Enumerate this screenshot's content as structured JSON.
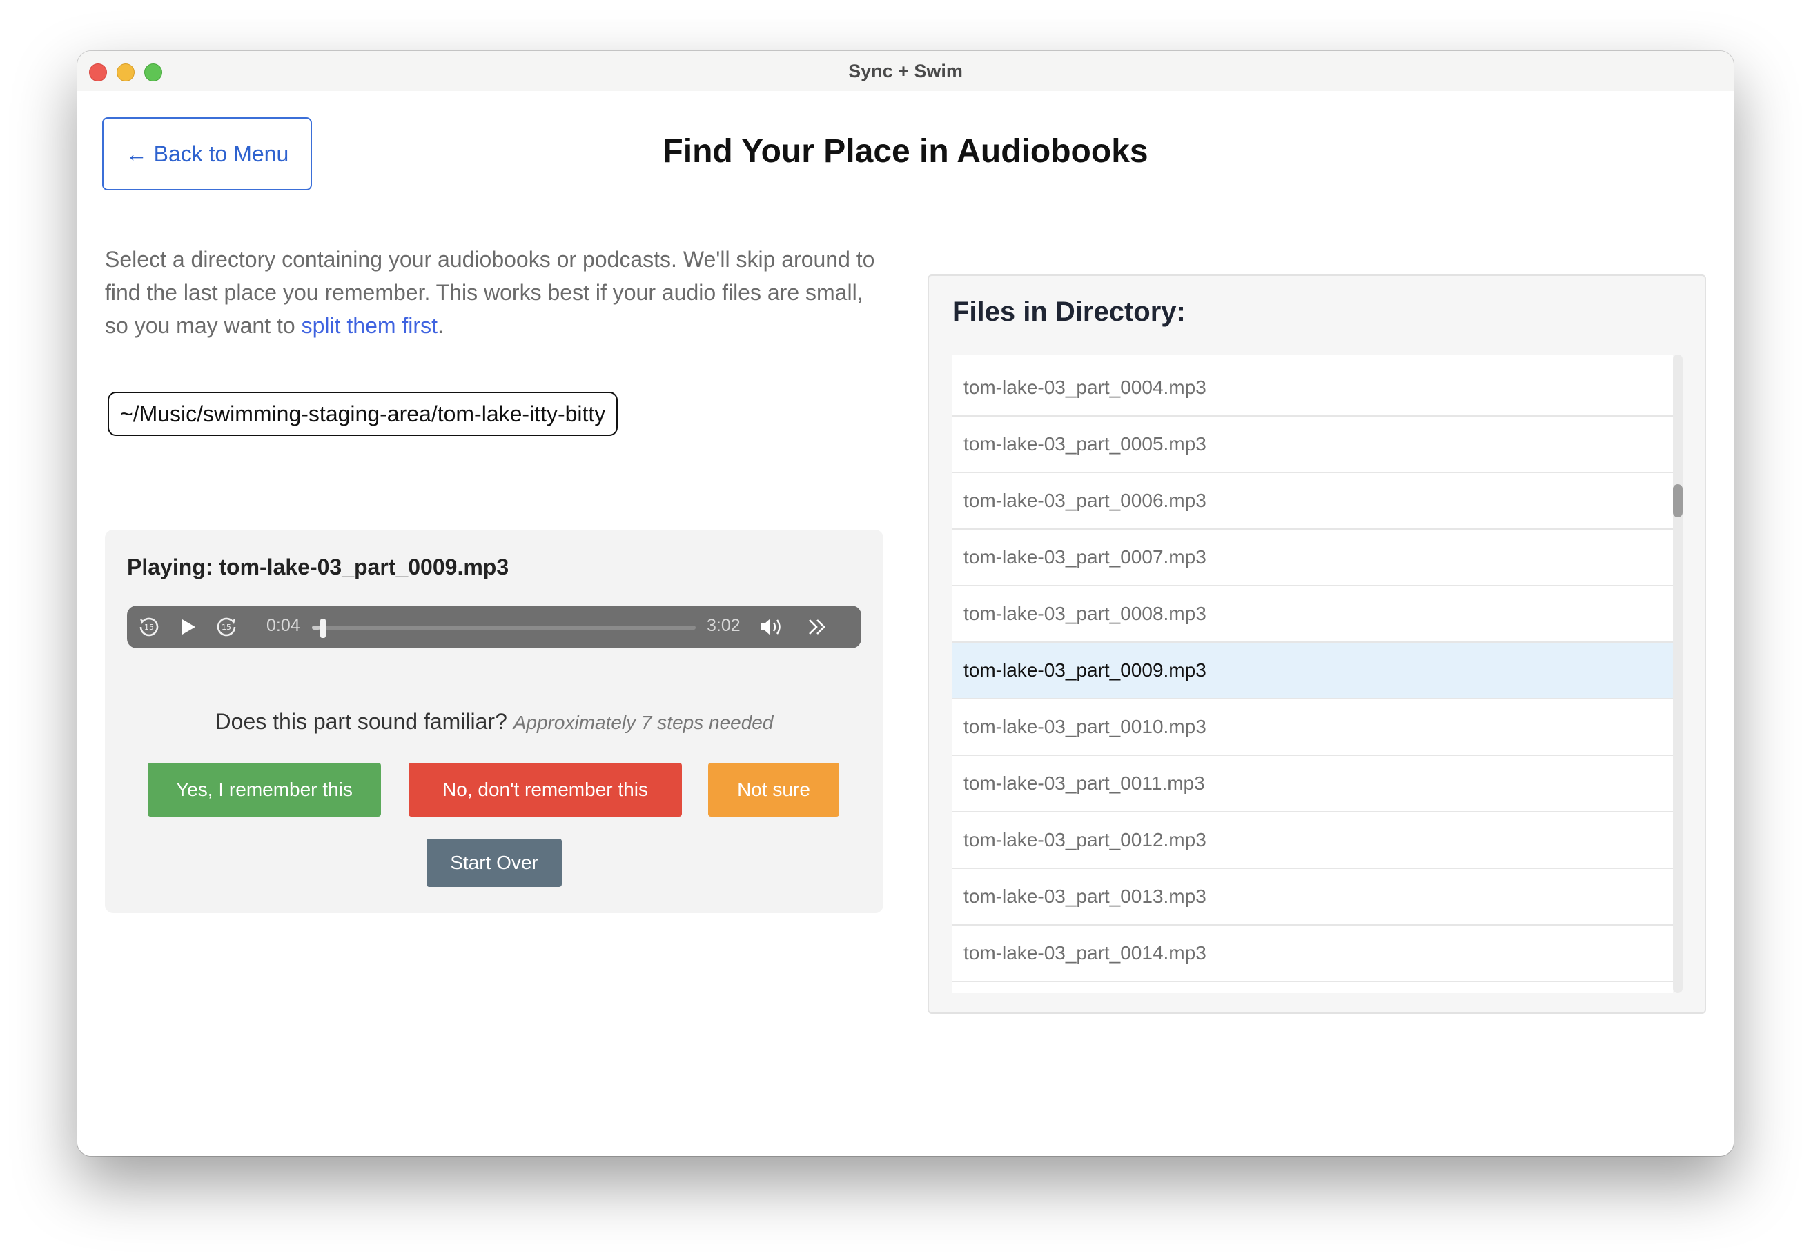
{
  "window": {
    "title": "Sync + Swim"
  },
  "nav": {
    "back_label": "← Back to Menu"
  },
  "page": {
    "title": "Find Your Place in Audiobooks"
  },
  "intro": {
    "text": "Select a directory containing your audiobooks or podcasts. We'll skip around to find the last place you remember. This works best if your audio files are small, so you may want to ",
    "link_text": "split them first",
    "suffix": "."
  },
  "directory": {
    "path": "~/Music/swimming-staging-area/tom-lake-itty-bitty"
  },
  "player": {
    "playing_label": "Playing: tom-lake-03_part_0009.mp3",
    "current_time": "0:04",
    "duration": "3:02",
    "progress_fraction": 0.022
  },
  "prompt": {
    "question": "Does this part sound familiar?",
    "hint": "Approximately 7 steps needed"
  },
  "actions": {
    "yes": "Yes, I remember this",
    "no": "No, don't remember this",
    "not_sure": "Not sure",
    "start_over": "Start Over"
  },
  "files": {
    "title": "Files in Directory:",
    "items": [
      "tom-lake-03_part_0004.mp3",
      "tom-lake-03_part_0005.mp3",
      "tom-lake-03_part_0006.mp3",
      "tom-lake-03_part_0007.mp3",
      "tom-lake-03_part_0008.mp3",
      "tom-lake-03_part_0009.mp3",
      "tom-lake-03_part_0010.mp3",
      "tom-lake-03_part_0011.mp3",
      "tom-lake-03_part_0012.mp3",
      "tom-lake-03_part_0013.mp3",
      "tom-lake-03_part_0014.mp3"
    ],
    "active_item": "tom-lake-03_part_0009.mp3"
  },
  "colors": {
    "accent_blue": "#3b6fd8",
    "yes_green": "#5ba95a",
    "no_red": "#e24b3c",
    "not_sure_orange": "#f3a03a",
    "reset_slate": "#5f7280",
    "active_row": "#e4f1fb"
  },
  "icons": {
    "skip_back": "rewind-15-icon",
    "play": "play-icon",
    "skip_forward": "forward-15-icon",
    "volume": "volume-icon",
    "speed": "double-chevron-right-icon"
  }
}
